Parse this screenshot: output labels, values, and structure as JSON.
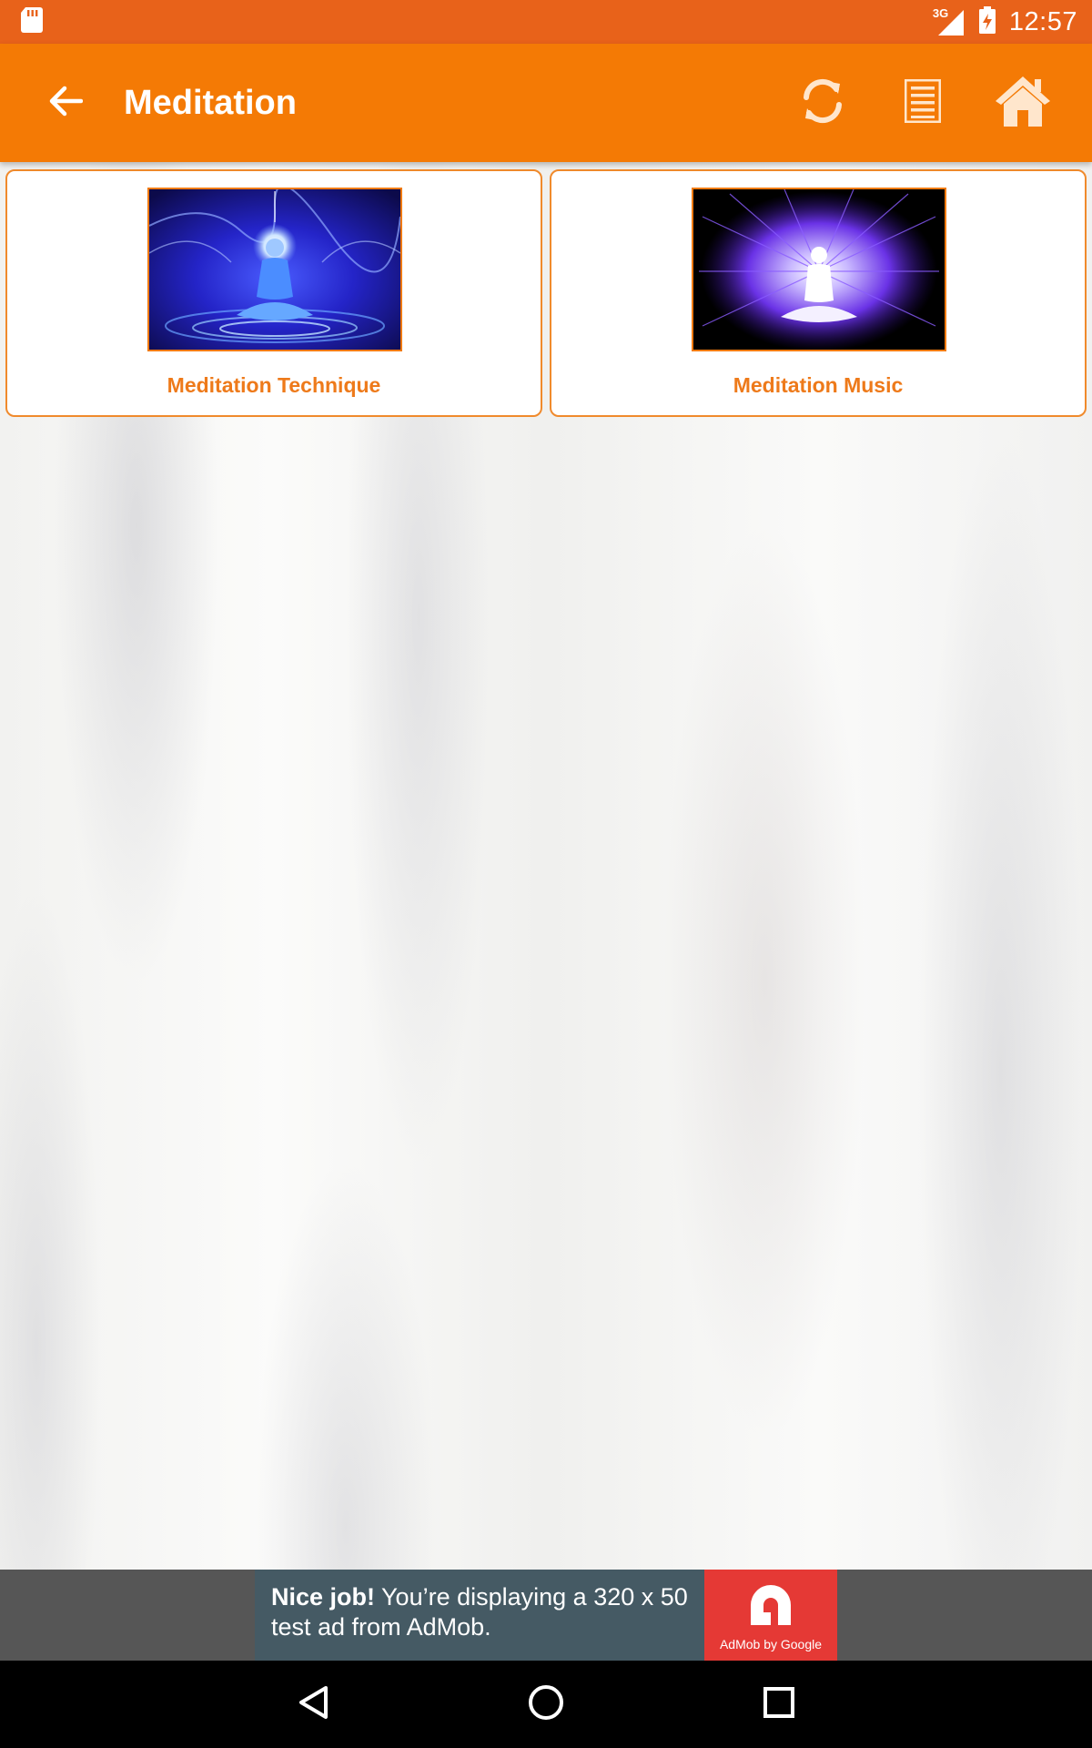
{
  "status_bar": {
    "time": "12:57",
    "network": "3G",
    "icons": [
      "sd-card-icon",
      "signal-icon",
      "battery-icon"
    ]
  },
  "app_bar": {
    "title": "Meditation",
    "actions": [
      "refresh-icon",
      "list-icon",
      "home-icon"
    ]
  },
  "cards": [
    {
      "label": "Meditation Technique",
      "image": "blue meditating buddha with halo"
    },
    {
      "label": "Meditation Music",
      "image": "glowing meditating figure with purple aura"
    }
  ],
  "ad": {
    "headline": "Nice job!",
    "body": " You’re displaying a 320 x 50 test ad from AdMob.",
    "logo_caption": "AdMob by Google"
  },
  "nav_bar": {
    "buttons": [
      "back-icon",
      "home-circle-icon",
      "recents-icon"
    ]
  },
  "colors": {
    "status_bar": "#e8621a",
    "app_bar": "#f47a05",
    "accent": "#ee7a1a",
    "ad_bg": "#455a64",
    "ad_logo_bg": "#e53935"
  }
}
